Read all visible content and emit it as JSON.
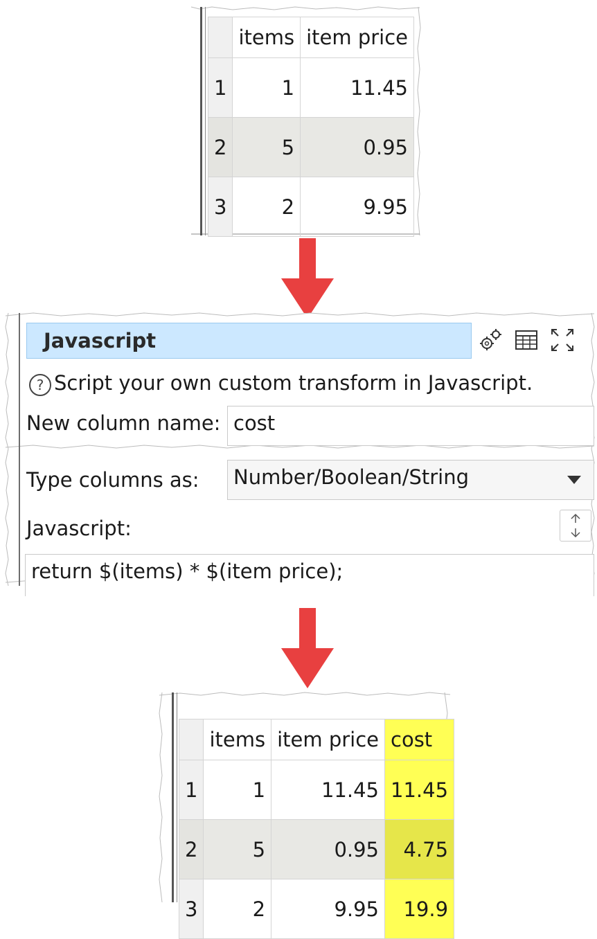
{
  "input_table": {
    "columns": [
      "items",
      "item price"
    ],
    "rows": [
      {
        "row": "1",
        "items": "1",
        "item_price": "11.45"
      },
      {
        "row": "2",
        "items": "5",
        "item_price": "0.95"
      },
      {
        "row": "3",
        "items": "2",
        "item_price": "9.95"
      }
    ]
  },
  "panel": {
    "title": "Javascript",
    "help_icon": "?",
    "description": "Script your own custom transform in Javascript.",
    "new_column_label": "New column name:",
    "new_column_value": "cost",
    "type_label": "Type columns as:",
    "type_value": "Number/Boolean/String",
    "script_label": "Javascript:",
    "script_value": "return $(items) * $(item price);",
    "icons": [
      "gear-icon",
      "table-icon",
      "maximize-icon",
      "resize-vertical-icon",
      "dropdown-arrow-icon"
    ]
  },
  "output_table": {
    "columns": [
      "items",
      "item price",
      "cost"
    ],
    "rows": [
      {
        "row": "1",
        "items": "1",
        "item_price": "11.45",
        "cost": "11.45"
      },
      {
        "row": "2",
        "items": "5",
        "item_price": "0.95",
        "cost": "4.75"
      },
      {
        "row": "3",
        "items": "2",
        "item_price": "9.95",
        "cost": "19.9"
      }
    ]
  },
  "colors": {
    "arrow": "#e84040",
    "highlight": "#ffff55",
    "titlebar": "#cce8ff",
    "alt_row": "#e8e8e4"
  }
}
